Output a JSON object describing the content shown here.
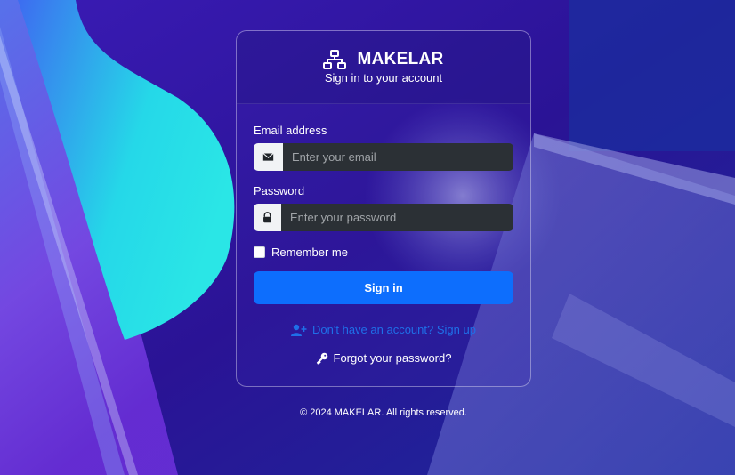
{
  "brand": {
    "name": "MAKELAR",
    "icon": "sitemap-icon"
  },
  "header": {
    "subtitle": "Sign in to your account"
  },
  "form": {
    "email": {
      "label": "Email address",
      "placeholder": "Enter your email",
      "value": "",
      "icon": "envelope-icon"
    },
    "password": {
      "label": "Password",
      "placeholder": "Enter your password",
      "value": "",
      "icon": "lock-icon"
    },
    "remember": {
      "label": "Remember me",
      "checked": false
    },
    "submit_label": "Sign in"
  },
  "links": {
    "signup": {
      "label": "Don't have an account? Sign up",
      "icon": "user-plus-icon"
    },
    "forgot": {
      "label": "Forgot your password?",
      "icon": "key-icon"
    }
  },
  "footer": {
    "text": "© 2024 MAKELAR. All rights reserved."
  },
  "colors": {
    "primary": "#0d6efd",
    "background": "#2a148f",
    "cyan_accent": "#25e1e6",
    "input_bg": "#2b3035"
  }
}
